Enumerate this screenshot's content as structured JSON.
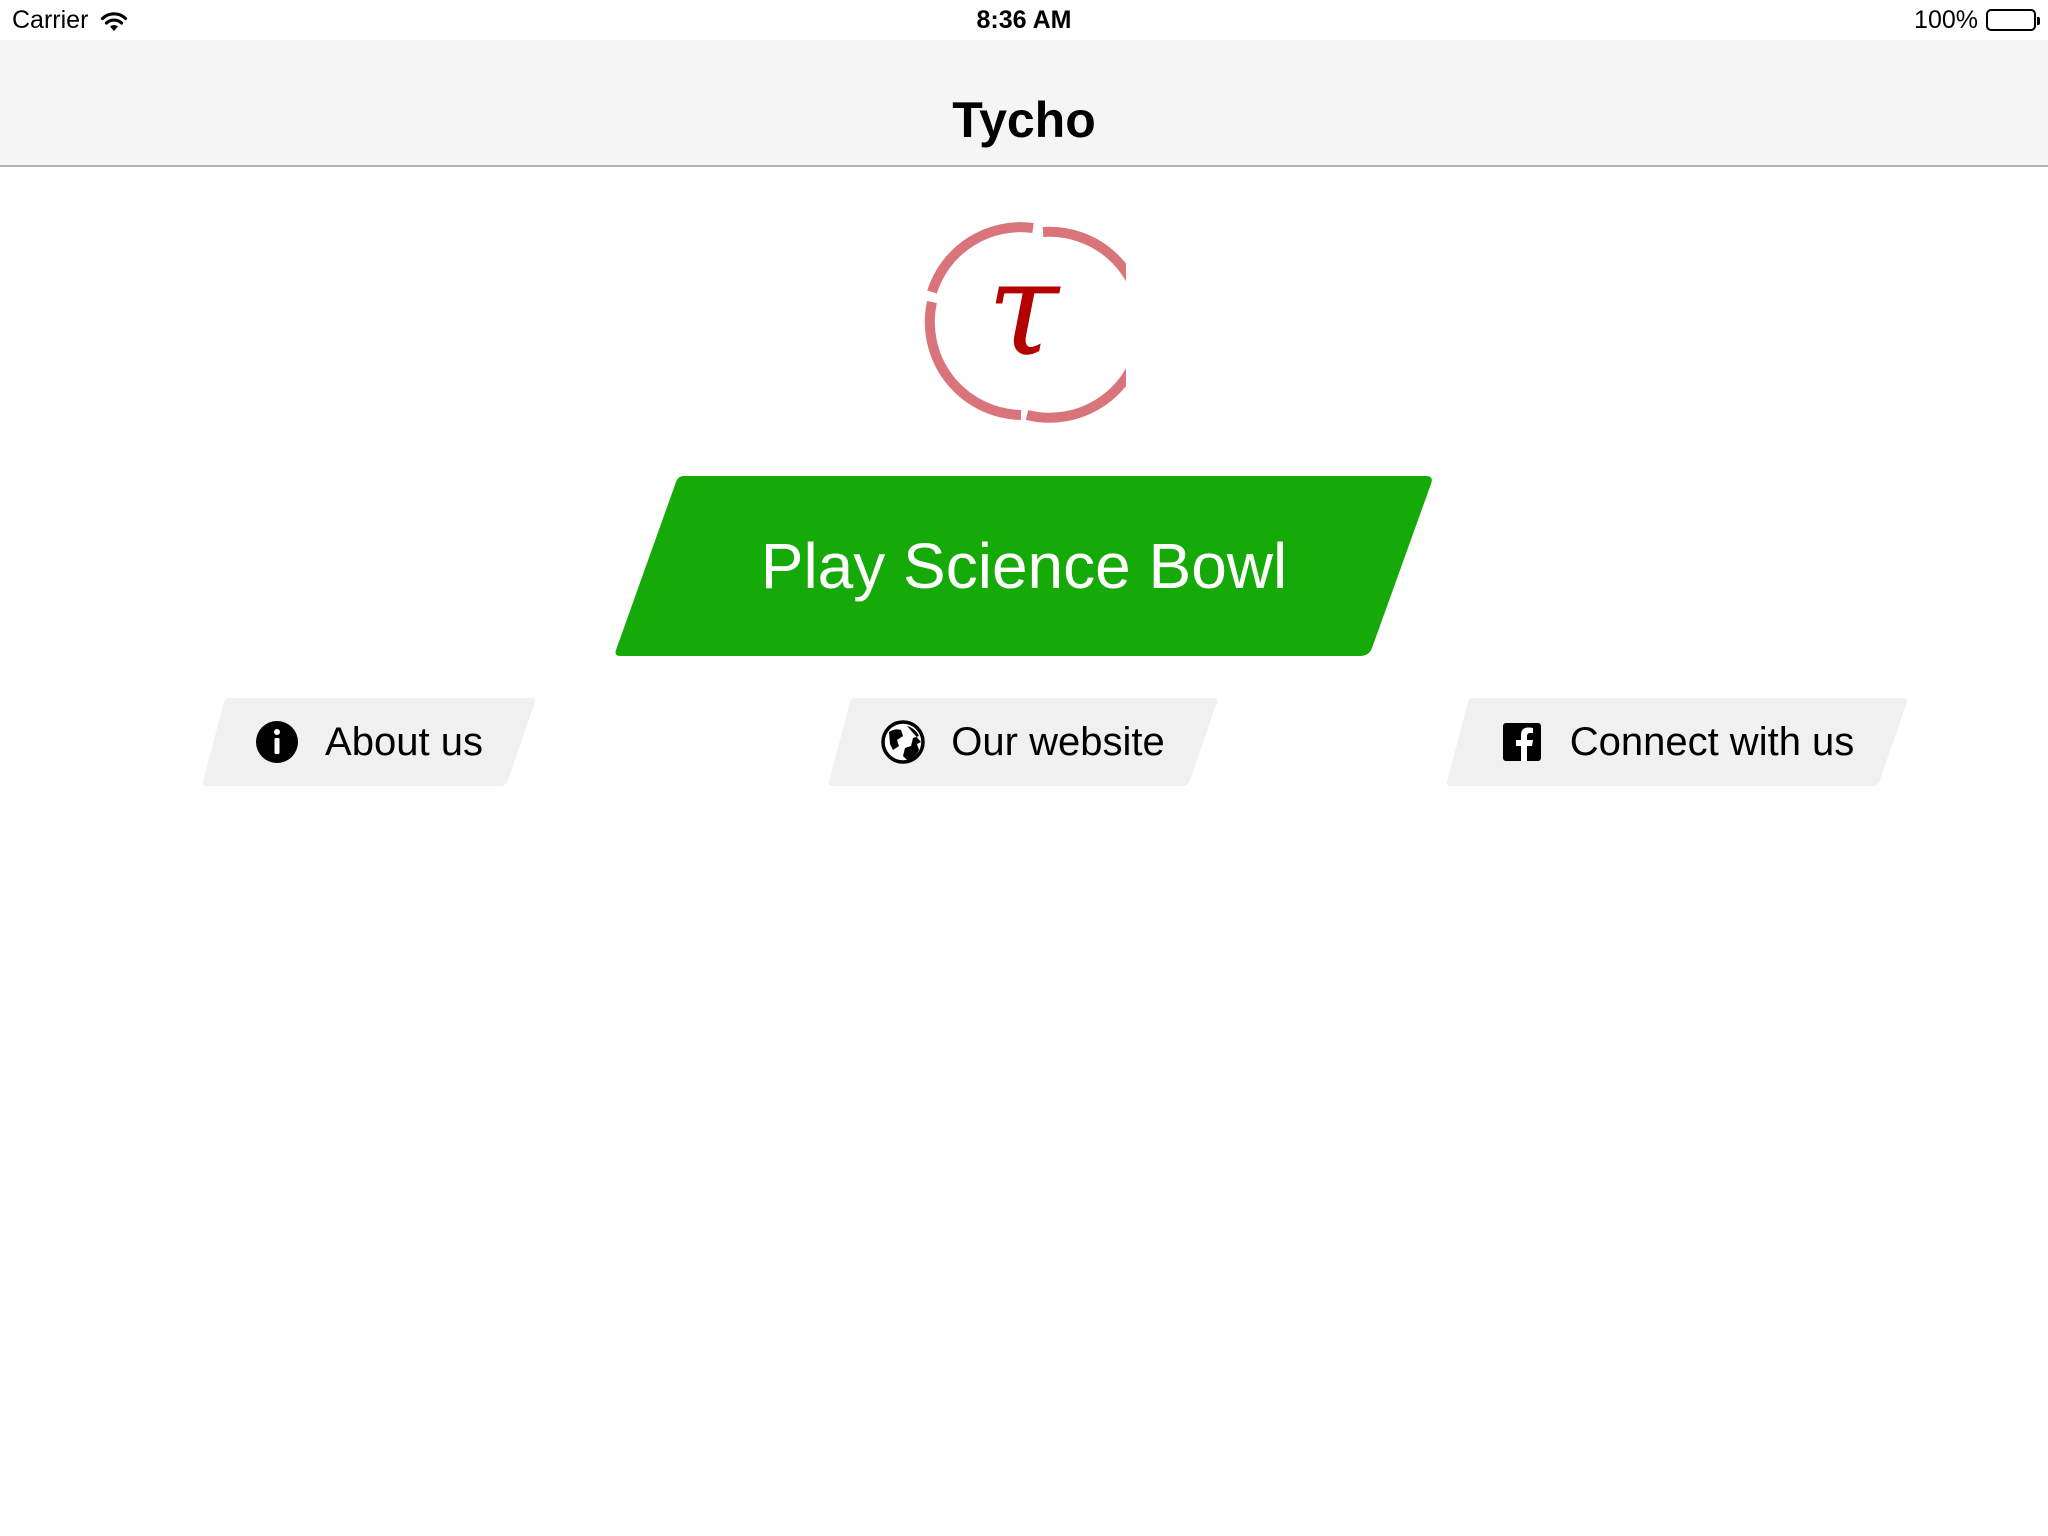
{
  "status_bar": {
    "carrier": "Carrier",
    "time": "8:36 AM",
    "battery": "100%"
  },
  "nav": {
    "title": "Tycho"
  },
  "logo": {
    "glyph": "τ",
    "ring_color": "#d9747a",
    "glyph_color": "#b30000"
  },
  "main": {
    "play_label": "Play Science Bowl",
    "play_color": "#15aa08"
  },
  "links": [
    {
      "label": "About us",
      "icon": "info-icon"
    },
    {
      "label": "Our website",
      "icon": "globe-icon"
    },
    {
      "label": "Connect with us",
      "icon": "facebook-icon"
    }
  ]
}
